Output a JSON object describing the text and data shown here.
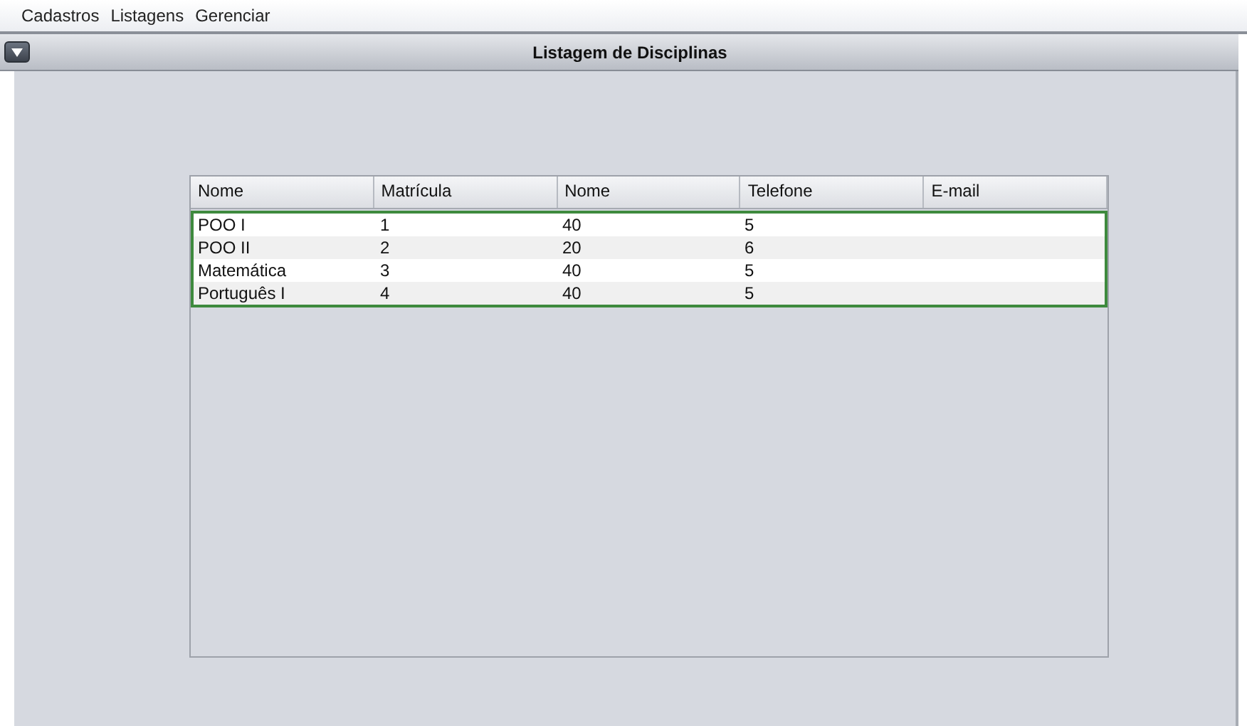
{
  "menu": [
    "Cadastros",
    "Listagens",
    "Gerenciar"
  ],
  "window": {
    "title": "Listagem de Disciplinas"
  },
  "table": {
    "focused": true,
    "columns": [
      "Nome",
      "Matrícula",
      "Nome",
      "Telefone",
      "E-mail"
    ],
    "rows": [
      [
        "POO I",
        "1",
        "40",
        "5"
      ],
      [
        "POO II",
        "2",
        "20",
        "6"
      ],
      [
        "Matemática",
        "3",
        "40",
        "5"
      ],
      [
        "Português I",
        "4",
        "40",
        "5"
      ]
    ]
  }
}
